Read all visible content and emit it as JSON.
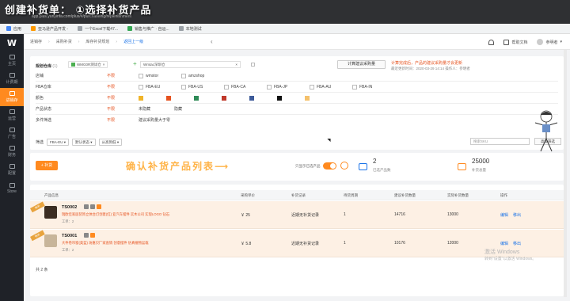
{
  "overlay": {
    "title": "创建补货单： ①选择补货产品",
    "annotation": "确认补货产品列表⟶"
  },
  "browser": {
    "url_strip": "app.plus.yunyinfa.com/plus/#/purchaseing/replenishment",
    "bookmarks": [
      "应用",
      "亚马逊产品开发 -",
      "一个Excel下载47...",
      "销售与推广 · 自运...",
      "本地测试"
    ]
  },
  "sidebar": {
    "logo": "W",
    "items": [
      {
        "label": "主页",
        "active": false
      },
      {
        "label": "计费期",
        "active": false
      },
      {
        "label": "进销存",
        "active": true
      },
      {
        "label": "运营",
        "active": false
      },
      {
        "label": "广告",
        "active": false
      },
      {
        "label": "财务",
        "active": false
      },
      {
        "label": "配置",
        "active": false
      },
      {
        "label": "Store",
        "active": false
      }
    ]
  },
  "topbar": {
    "crumbs": [
      "进销存",
      "采购补货",
      "库存补货规划"
    ],
    "back": "返回上一级",
    "help": "帮助文档",
    "user": "参明者"
  },
  "filters": {
    "heading": "规划仓库",
    "count": "(1)",
    "warehouse1": "WMG0R测试仓",
    "warehouse2": "Wmtac深圳仓",
    "calc_button": "计算建议采购量",
    "calc_tip": "计算完成后，产品的建议采购量才会更新",
    "calc_sub": "最近更新时间：2020-03-29 14:14 操作人：参明者",
    "unlimited": "不限",
    "rows": [
      {
        "label": "店铺",
        "options": [
          "wmstor",
          "amzshop"
        ]
      },
      {
        "label": "FBA仓库",
        "options": [
          "FBA-EU",
          "FBA-US",
          "FBA-CA",
          "FBA-JP",
          "FBA-AU",
          "FBA-IN"
        ]
      },
      {
        "label": "颜色",
        "colors": [
          "#f0b429",
          "#e6521f",
          "#2e8b57",
          "#c0392b",
          "#3d5a99",
          "#111111",
          "#f5c16c"
        ]
      },
      {
        "label": "产品状态",
        "options": [
          "未隐藏",
          "隐藏"
        ]
      },
      {
        "label": "多件筛选",
        "options": [
          "建议采购量大于零"
        ]
      }
    ],
    "search": {
      "label": "筛选",
      "select1": "FBA-EU",
      "select2": "默认状态",
      "select3": "从高到低",
      "placeholder": "搜索SKU",
      "advanced": "高级筛选"
    }
  },
  "stats": {
    "add_button": "补货",
    "toggle_label": "只显示已选产品",
    "selected_count": "2",
    "selected_label": "已选产品数",
    "total_count": "25000",
    "total_label": "补货总量"
  },
  "table": {
    "headers": [
      "产品信息",
      "采购单价",
      "补货记录",
      "待货周期",
      "建议补货数量",
      "实际补货数量",
      "操作"
    ],
    "rows": [
      {
        "ribbon": "待补",
        "sku": "TS0002",
        "name": "瑞欧佳家居装饰立体台灯创意(红) 亚汽车摆件 实木公司 实现LOGO 钻石",
        "brand": "工单：2",
        "price": "￥ 25",
        "history": "近期无补货记录",
        "cycle": "1",
        "suggested": "14716",
        "actual": "13000",
        "edit": "编辑",
        "remove": "移出"
      },
      {
        "ribbon": "待补",
        "sku": "TS0001",
        "name": "大件卷帘窗(奥蓝) 坊嘉贝厂家直销 创意摆件 仿真植物盆栽",
        "brand": "工单：2",
        "price": "￥ 5.8",
        "history": "近期无补货记录",
        "cycle": "1",
        "suggested": "10176",
        "actual": "12000",
        "edit": "编辑",
        "remove": "移出"
      }
    ],
    "pager": "共 2 条"
  },
  "watermark": {
    "line1": "激活 Windows",
    "line2": "转到\"设置\"以激活 Windows。"
  }
}
